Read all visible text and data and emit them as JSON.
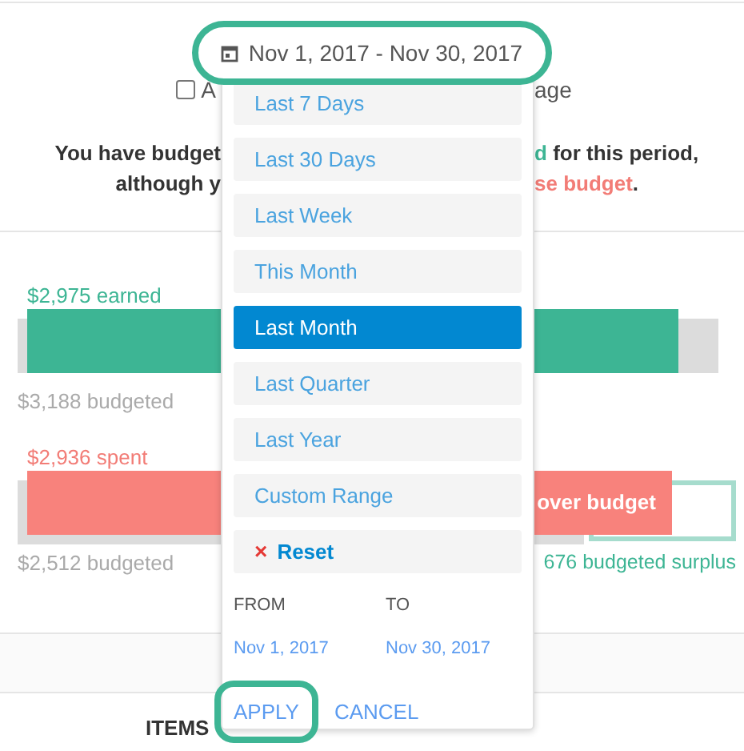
{
  "date_range_button": {
    "label": "Nov 1, 2017 - Nov 30, 2017",
    "highlighted": true
  },
  "show_checkbox": {
    "label_start": "A",
    "label_end": "age",
    "checked": false
  },
  "summary_lines": [
    {
      "left": [
        {
          "text": "You have budget",
          "color": "#333333"
        }
      ],
      "right": [
        {
          "text": "d",
          "color": "#3db594"
        },
        {
          "text": " for this period,",
          "color": "#333333"
        }
      ]
    },
    {
      "left": [
        {
          "text": "although y",
          "color": "#333333"
        }
      ],
      "right": [
        {
          "text": "se budget",
          "color": "#f27c76"
        },
        {
          "text": ".",
          "color": "#333333"
        }
      ]
    }
  ],
  "earned": {
    "label": "$2,975 earned",
    "level": 0.93,
    "budget_label": "$3,188 budgeted"
  },
  "spent": {
    "label": "$2,936 spent",
    "bar_text": "over budget",
    "budget_label": "$2,512 budgeted",
    "surplus_label": "676 budgeted surplus"
  },
  "items_header": "ITEMS",
  "date_picker": {
    "presets": [
      {
        "label": "Last 7 Days",
        "selected": false
      },
      {
        "label": "Last 30 Days",
        "selected": false
      },
      {
        "label": "Last Week",
        "selected": false
      },
      {
        "label": "This Month",
        "selected": false
      },
      {
        "label": "Last Month",
        "selected": true
      },
      {
        "label": "Last Quarter",
        "selected": false
      },
      {
        "label": "Last Year",
        "selected": false
      },
      {
        "label": "Custom Range",
        "selected": false
      }
    ],
    "reset": {
      "icon": "×",
      "label": "Reset"
    },
    "from": {
      "label": "FROM",
      "value": "Nov 1, 2017"
    },
    "to": {
      "label": "TO",
      "value": "Nov 30, 2017"
    },
    "apply": {
      "label": "APPLY",
      "highlighted": true
    },
    "cancel": "CANCEL"
  }
}
